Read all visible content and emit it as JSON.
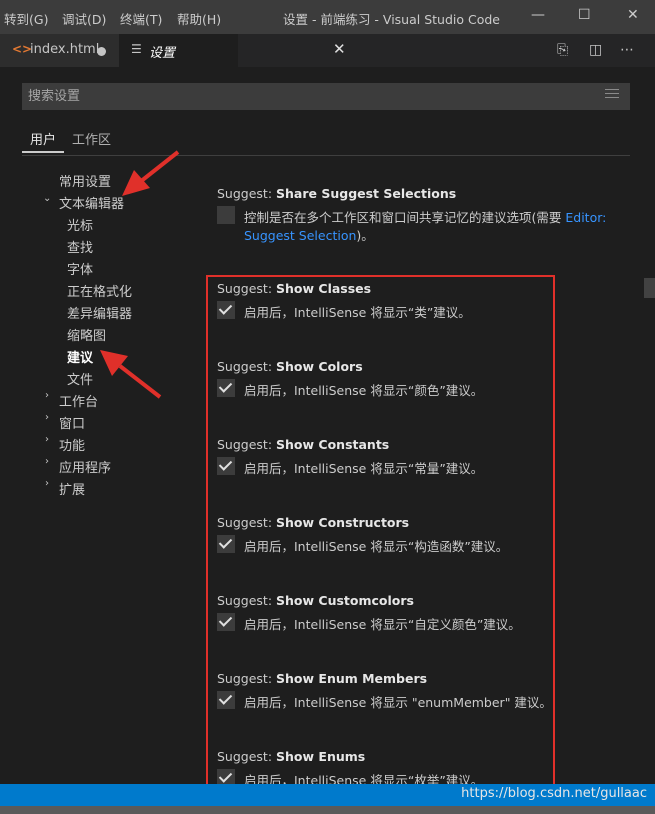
{
  "titlebar": {
    "menu": [
      "转到(G)",
      "调试(D)",
      "终端(T)",
      "帮助(H)"
    ],
    "title": "设置 - 前端练习 - Visual Studio Code",
    "minimize": "—",
    "maximize": "☐",
    "close": "✕"
  },
  "tabs": [
    {
      "label": "index.html",
      "icon": "html-tag-icon",
      "dirty": true
    },
    {
      "label": "设置",
      "icon": "settings-icon",
      "active": true,
      "close": "✕"
    }
  ],
  "editor_actions": {
    "open_json": "⎘",
    "split": "◫",
    "more": "⋯"
  },
  "search": {
    "placeholder": "搜索设置"
  },
  "scope_tabs": {
    "user": "用户",
    "workspace": "工作区"
  },
  "toc": {
    "common": "常用设置",
    "text_editor": "文本编辑器",
    "text_editor_children": [
      "光标",
      "查找",
      "字体",
      "正在格式化",
      "差异编辑器",
      "缩略图",
      "建议",
      "文件"
    ],
    "others": [
      "工作台",
      "窗口",
      "功能",
      "应用程序",
      "扩展"
    ],
    "expanded_chevron": "⌄",
    "collapsed_chevron": "›"
  },
  "settings": {
    "share": {
      "prefix": "Suggest: ",
      "name": "Share Suggest Selections",
      "desc_line1": "控制是否在多个工作区和窗口间共享记忆的建议选项(需要 ",
      "link1": "Editor:",
      "link2": "Suggest Selection",
      "desc_end": ")。",
      "checked": false
    },
    "items": [
      {
        "prefix": "Suggest: ",
        "name": "Show Classes",
        "desc": "启用后，IntelliSense 将显示“类”建议。",
        "checked": true
      },
      {
        "prefix": "Suggest: ",
        "name": "Show Colors",
        "desc": "启用后，IntelliSense 将显示“颜色”建议。",
        "checked": true
      },
      {
        "prefix": "Suggest: ",
        "name": "Show Constants",
        "desc": "启用后，IntelliSense 将显示“常量”建议。",
        "checked": true
      },
      {
        "prefix": "Suggest: ",
        "name": "Show Constructors",
        "desc": "启用后，IntelliSense 将显示“构造函数”建议。",
        "checked": true
      },
      {
        "prefix": "Suggest: ",
        "name": "Show Customcolors",
        "desc": "启用后，IntelliSense 将显示“自定义颜色”建议。",
        "checked": true
      },
      {
        "prefix": "Suggest: ",
        "name": "Show Enum Members",
        "desc": "启用后，IntelliSense 将显示 \"enumMember\" 建议。",
        "checked": true
      },
      {
        "prefix": "Suggest: ",
        "name": "Show Enums",
        "desc": "启用后，IntelliSense 将显示“枚举”建议。",
        "checked": true
      }
    ]
  },
  "statusbar": {
    "watermark": "https://blog.csdn.net/gullaac"
  },
  "colors": {
    "accent": "#007acc",
    "highlight": "#e0302a",
    "link": "#3794ff"
  }
}
